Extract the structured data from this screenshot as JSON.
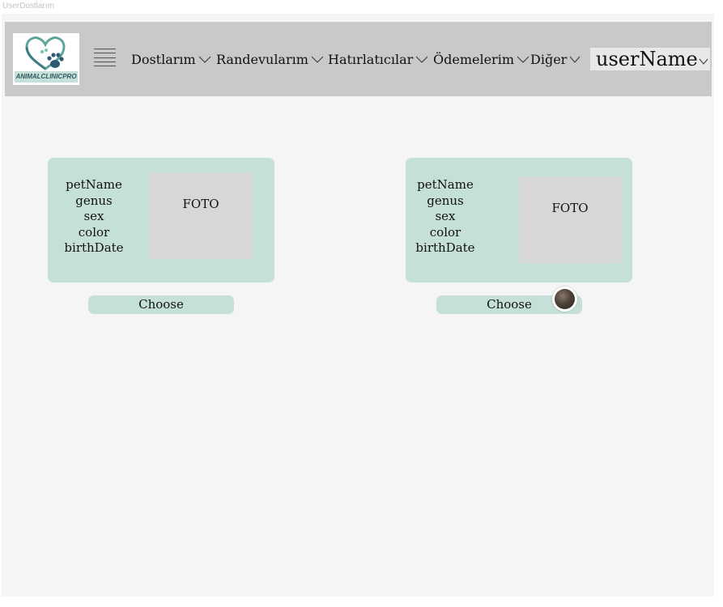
{
  "frame": {
    "title": "UserDostlarım"
  },
  "logo": {
    "text": "ANIMALCLINICPRO"
  },
  "nav": {
    "items": [
      {
        "label": "Dostlarım"
      },
      {
        "label": "Randevularım"
      },
      {
        "label": "Hatırlatıcılar"
      },
      {
        "label": "Ödemelerim"
      },
      {
        "label": "Diğer"
      }
    ],
    "user": {
      "name": "userName"
    }
  },
  "cards": [
    {
      "fields": [
        "petName",
        "genus",
        "sex",
        "color",
        "birthDate"
      ],
      "photo_label": "FOTO",
      "button": "Choose"
    },
    {
      "fields": [
        "petName",
        "genus",
        "sex",
        "color",
        "birthDate"
      ],
      "photo_label": "FOTO",
      "button": "Choose"
    }
  ],
  "colors": {
    "navbar": "#c9c9c9",
    "card": "#c5e0d8",
    "photo": "#d7d7d7",
    "canvas": "#f5f5f5"
  }
}
